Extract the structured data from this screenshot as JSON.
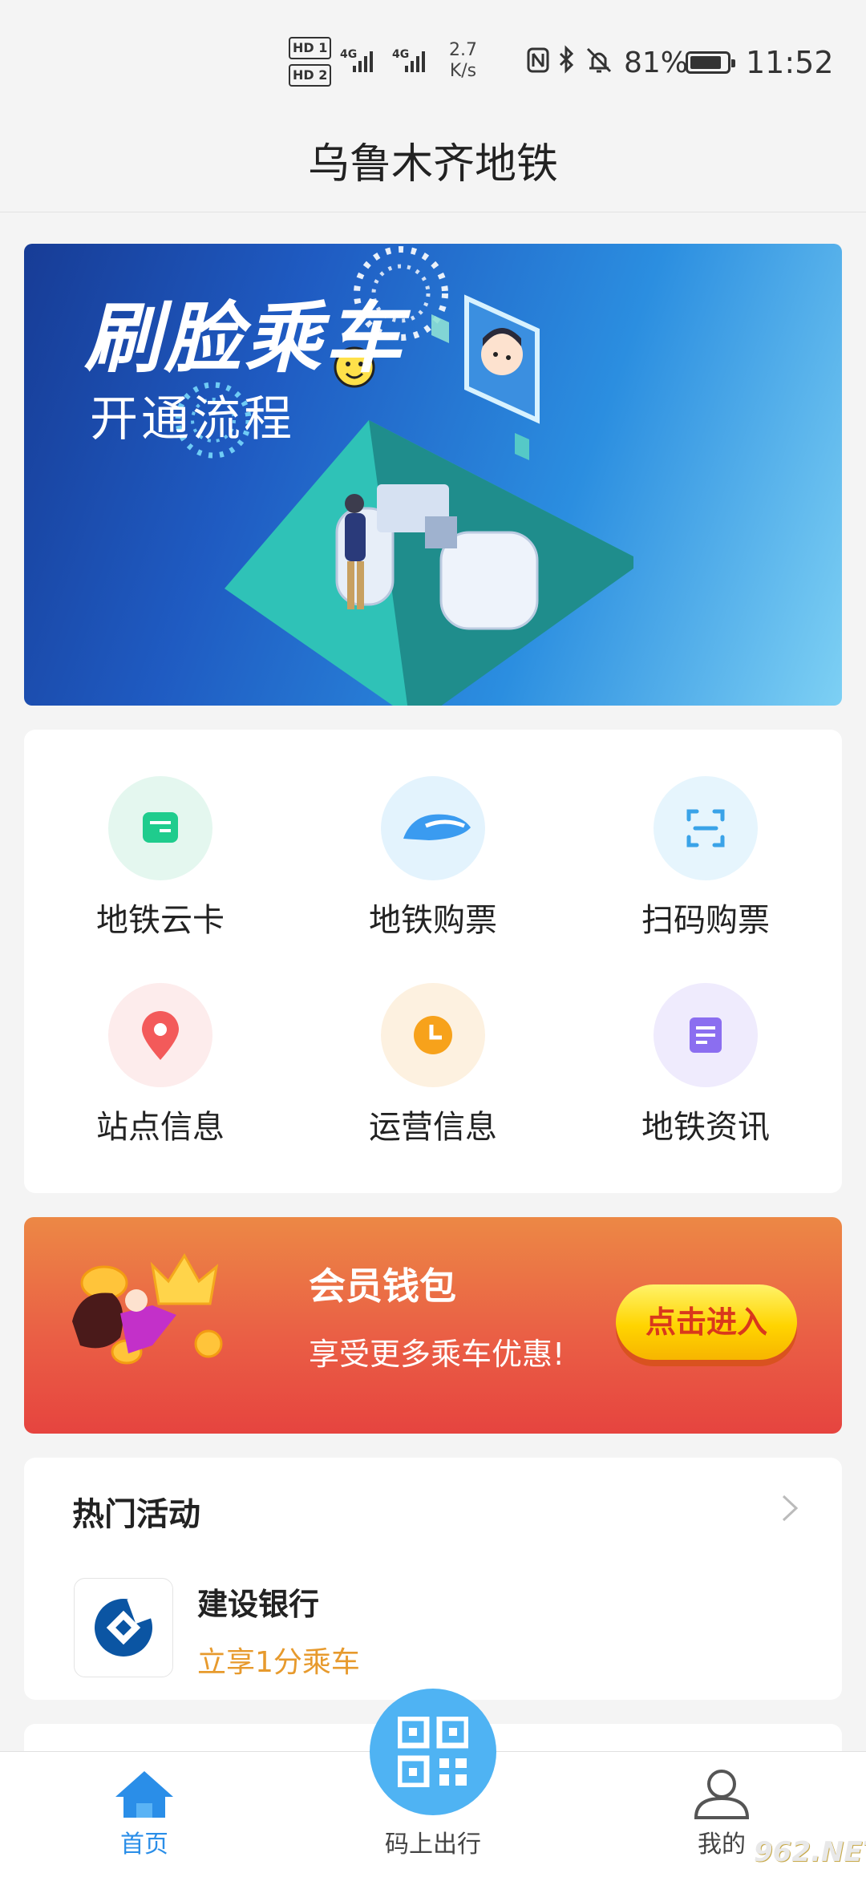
{
  "status_bar": {
    "hd1": "HD 1",
    "hd2": "HD 2",
    "signal1": "4G",
    "signal2": "4G",
    "speed_value": "2.7",
    "speed_unit": "K/s",
    "battery": "81%",
    "time": "11:52"
  },
  "header": {
    "title": "乌鲁木齐地铁"
  },
  "banner": {
    "title": "刷脸乘车",
    "subtitle": "开通流程"
  },
  "services": [
    {
      "label": "地铁云卡",
      "icon": "card-icon",
      "color": "#1fcc8d",
      "bg": "#e4f7ef"
    },
    {
      "label": "地铁购票",
      "icon": "train-icon",
      "color": "#3a9bf0",
      "bg": "#e3f3fd"
    },
    {
      "label": "扫码购票",
      "icon": "scan-icon",
      "color": "#3aa3e8",
      "bg": "#e6f5fd"
    },
    {
      "label": "站点信息",
      "icon": "location-pin-icon",
      "color": "#f35a5a",
      "bg": "#fdecec"
    },
    {
      "label": "运营信息",
      "icon": "clock-icon",
      "color": "#f7a21b",
      "bg": "#fdf1e0"
    },
    {
      "label": "地铁资讯",
      "icon": "news-icon",
      "color": "#8b6ef0",
      "bg": "#efebfd"
    }
  ],
  "member": {
    "title": "会员钱包",
    "subtitle": "享受更多乘车优惠!",
    "button": "点击进入"
  },
  "hot": {
    "title": "热门活动",
    "item": {
      "name": "建设银行",
      "desc": "立享1分乘车"
    }
  },
  "bottom_nav": {
    "home": "首页",
    "qr": "码上出行",
    "mine": "我的"
  },
  "watermark": "962.NET"
}
